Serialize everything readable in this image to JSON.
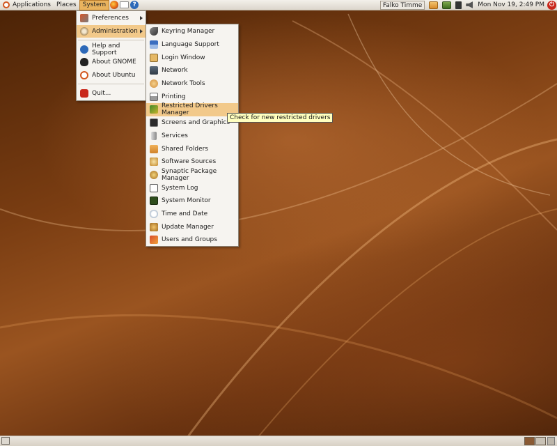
{
  "panel": {
    "menus": [
      "Applications",
      "Places",
      "System"
    ],
    "user": "Falko Timme",
    "clock": "Mon Nov 19,  2:49 PM"
  },
  "system_menu": {
    "items": [
      {
        "label": "Preferences",
        "icon": "preferences-icon",
        "submenu": true
      },
      {
        "label": "Administration",
        "icon": "administration-icon",
        "submenu": true
      },
      {
        "label": "Help and Support",
        "icon": "help-icon"
      },
      {
        "label": "About GNOME",
        "icon": "gnome-foot-icon"
      },
      {
        "label": "About Ubuntu",
        "icon": "ubuntu-logo-icon"
      },
      {
        "label": "Quit...",
        "icon": "power-icon"
      }
    ]
  },
  "admin_menu": {
    "items": [
      {
        "label": "Keyring Manager",
        "icon": "keyring-icon"
      },
      {
        "label": "Language Support",
        "icon": "language-flag-icon"
      },
      {
        "label": "Login Window",
        "icon": "login-window-icon"
      },
      {
        "label": "Network",
        "icon": "network-icon"
      },
      {
        "label": "Network Tools",
        "icon": "network-tools-icon"
      },
      {
        "label": "Printing",
        "icon": "printer-icon"
      },
      {
        "label": "Restricted Drivers Manager",
        "icon": "restricted-drivers-icon"
      },
      {
        "label": "Screens and Graphics",
        "icon": "monitor-icon"
      },
      {
        "label": "Services",
        "icon": "services-icon"
      },
      {
        "label": "Shared Folders",
        "icon": "shared-folder-icon"
      },
      {
        "label": "Software Sources",
        "icon": "software-sources-icon"
      },
      {
        "label": "Synaptic Package Manager",
        "icon": "synaptic-icon"
      },
      {
        "label": "System Log",
        "icon": "system-log-icon"
      },
      {
        "label": "System Monitor",
        "icon": "system-monitor-icon"
      },
      {
        "label": "Time and Date",
        "icon": "clock-icon"
      },
      {
        "label": "Update Manager",
        "icon": "update-manager-icon"
      },
      {
        "label": "Users and Groups",
        "icon": "users-groups-icon"
      }
    ]
  },
  "tooltip": "Check for new restricted drivers",
  "colors": {
    "accent": "#f2c98a",
    "wallpaper": "#7a3d12"
  }
}
